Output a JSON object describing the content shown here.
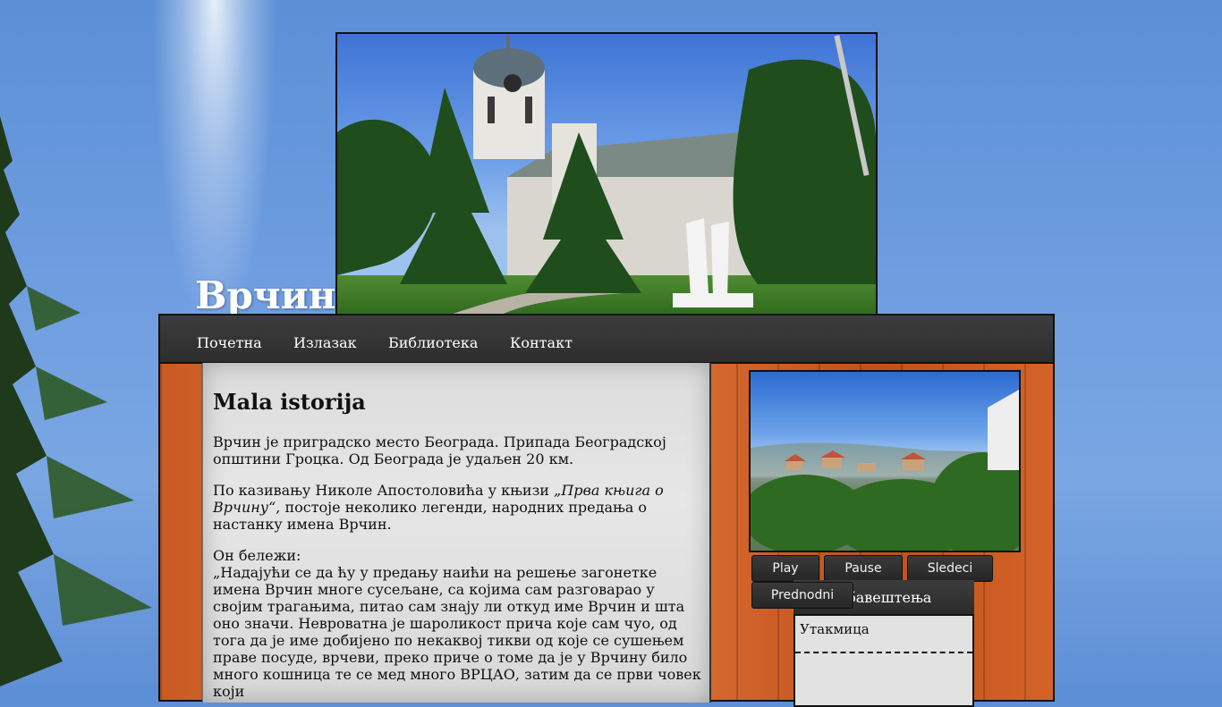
{
  "site": {
    "title": "Врчин"
  },
  "nav": {
    "items": [
      "Почетна",
      "Излазак",
      "Библиотека",
      "Контакт"
    ]
  },
  "article": {
    "heading": "Mala istorija",
    "p1": "Врчин је приградско место Београда. Припада Београдској општини Гроцка. Од Београда је удаљен 20 км.",
    "p2_before": "По казивању Николе Апостоловића у књизи ",
    "p2_book": "„Прва књига о Врчину“",
    "p2_after": ", постоје неколико легенди, народних предања о настанку имена Врчин.",
    "p3_intro": "Он бележи:",
    "p3_quote": "„Надајући се да ћу у предању наићи на решење загонетке имена Врчин многе сусељане, са којима сам разговарао у своjим трагањима, питао сам знају ли откуд име Врчин и шта оно значи. Невроватна је шароликост прича које сам чуо, од тога да је име добијено по некаквој тикви од које се сушењем праве посуде, врчеви, преко приче о томе да је у Врчину било много кошница те се мед много ВРЦАО, затим да се први човек који"
  },
  "slider": {
    "buttons": {
      "play": "Play",
      "pause": "Pause",
      "next": "Sledeci",
      "prev": "Prednodni"
    }
  },
  "notices": {
    "heading": "Обавештења",
    "items": [
      "Утакмица"
    ]
  },
  "colors": {
    "sky": "#5b8fd6",
    "wood": "#c85a24",
    "navbar": "#333333",
    "paper": "#dcdcdc"
  }
}
